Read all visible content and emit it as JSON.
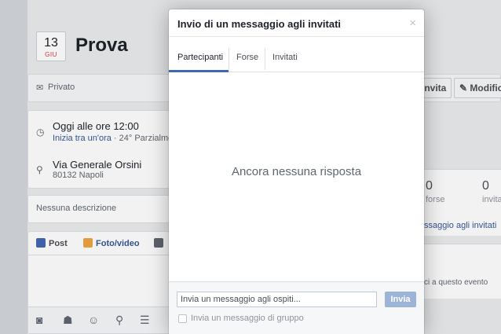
{
  "event": {
    "date_day": "13",
    "date_month": "GIU",
    "title": "Prova",
    "privacy": "Privato"
  },
  "actions": {
    "invite_label": "Invita",
    "edit_label": "Modific"
  },
  "details": {
    "time_main": "Oggi alle ore 12:00",
    "time_link": "Inizia tra un'ora",
    "time_weather": " · 24° Parzialmen",
    "address_main": "Via Generale Orsini",
    "address_sub": "80132 Napoli",
    "no_description": "Nessuna descrizione"
  },
  "composer": {
    "tab_post": "Post",
    "tab_photo": "Foto/video"
  },
  "stats": {
    "maybe_count": "0",
    "maybe_label": "forse",
    "invited_count": "0",
    "invited_label": "invita",
    "message_guests_link": "ssaggio agli invitati",
    "invite_to_event": "ci a questo evento"
  },
  "dialog": {
    "title": "Invio di un messaggio agli invitati",
    "close_glyph": "×",
    "tabs": [
      "Partecipanti",
      "Forse",
      "Invitati"
    ],
    "empty_text": "Ancora nessuna risposta",
    "input_placeholder": "Invia un messaggio agli ospiti...",
    "send_label": "Invia",
    "group_checkbox_label": "Invia un messaggio di gruppo"
  },
  "colors": {
    "accent": "#4267b2",
    "link": "#365899",
    "send_disabled": "#9cb4d8"
  }
}
